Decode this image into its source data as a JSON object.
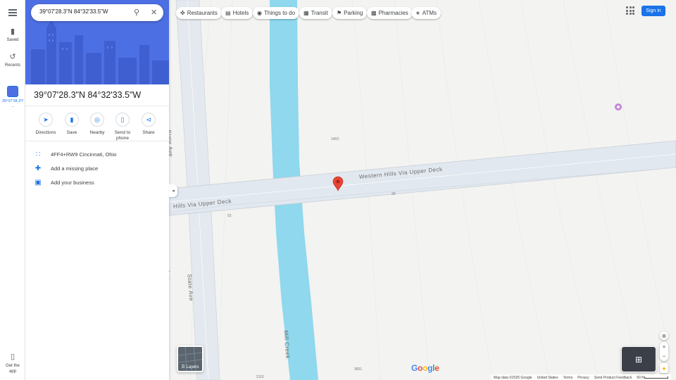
{
  "search": {
    "value": "39°07'28.3\"N 84°32'33.5\"W"
  },
  "rail": {
    "saved_label": "Saved",
    "recents_label": "Recents",
    "recent_item_label": "39°07'28.3\"N ...",
    "get_app_label": "Get the app"
  },
  "place": {
    "title": "39°07'28.3\"N 84°32'33.5\"W",
    "actions": [
      {
        "label": "Directions",
        "icon": "directions-icon"
      },
      {
        "label": "Save",
        "icon": "bookmark-icon"
      },
      {
        "label": "Nearby",
        "icon": "nearby-icon"
      },
      {
        "label": "Send to phone",
        "icon": "phone-icon"
      },
      {
        "label": "Share",
        "icon": "share-icon"
      }
    ],
    "plus_code": "4FF4+RW9 Cincinnati, Ohio",
    "add_missing_place": "Add a missing place",
    "add_business": "Add your business"
  },
  "chips": [
    {
      "label": "Restaurants",
      "icon": "fork-knife-icon"
    },
    {
      "label": "Hotels",
      "icon": "bed-icon"
    },
    {
      "label": "Things to do",
      "icon": "camera-icon"
    },
    {
      "label": "Transit",
      "icon": "train-icon"
    },
    {
      "label": "Parking",
      "icon": "parking-icon"
    },
    {
      "label": "Pharmacies",
      "icon": "pharmacy-icon"
    },
    {
      "label": "ATMs",
      "icon": "atm-icon"
    }
  ],
  "header": {
    "signin_label": "Sign in"
  },
  "map": {
    "road_labels": {
      "via_right": "Western Hills Via Upper Deck",
      "via_left": "Hills Via Upper Deck",
      "state_ave_top": "State Ave",
      "state_ave_bottom_left": "State Ave",
      "state_ave_bottom_right": "State Ave",
      "mill_creek": "Mill Creek"
    },
    "numbers": {
      "n1403": "1403",
      "n20": "20",
      "n52": "52",
      "n2110": "2110",
      "n3601": "3601"
    },
    "layers_label": "Layers",
    "logo_text": "Google",
    "colors": {
      "water": "#8fd8ee",
      "road": "#dfe5ec",
      "road_edge": "#c9d0d8",
      "pin": "#ea4335",
      "accent": "#1a73e8",
      "hero": "#4c6fe3"
    }
  },
  "footer": {
    "map_data": "Map data ©2025 Google",
    "country": "United States",
    "terms": "Terms",
    "privacy": "Privacy",
    "feedback": "Send Product Feedback",
    "scale": "50 ft"
  }
}
